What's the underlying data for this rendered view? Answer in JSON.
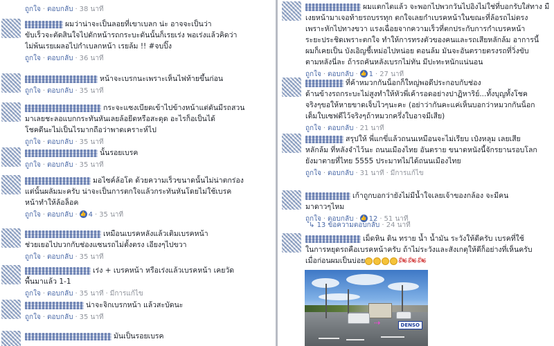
{
  "labels": {
    "like": "ถูกใจ",
    "reply": "ตอบกลับ",
    "edited": "มีการแก้ไข"
  },
  "left": [
    {
      "id": "c0",
      "lines": [],
      "time": "38 นาที",
      "edited": false,
      "reaction": null
    },
    {
      "id": "c1",
      "name_len": 55,
      "lines": [
        "ผมว่าน่าจะเป็นลอยที่เขาเบลก น่ะ อาจจะเป็นว่า",
        "ขับเร็วจะตัดสินใจไปดักหน้ารถกระบะดันนั้นก็เรยเร่ง พอเร่งแล้วคิดว่า",
        "ไม่พ้นเรยเผลอไปกำเบลกหน้า เรยล้ม !! #จบปิ๊ง"
      ],
      "time": "36 นาที",
      "edited": false,
      "reaction": null
    },
    {
      "id": "c2",
      "name_len": 105,
      "lines": [
        "หน้าจะเบรกนะเพราะเห็นไฟท้ายขึ้นก่อน"
      ],
      "time": "35 นาที",
      "edited": false,
      "reaction": null
    },
    {
      "id": "c3",
      "name_len": 110,
      "lines": [
        "กระจะแซงเบียดเข้าไปข้างหน้าแต่ดันมีรถสวน",
        "มาเลยชะลอแบกกระทันหันเลยล้อยีดหรือสะดุด อะไรก็อเป็นได้",
        "โชคดีนะไม่เป็นไรมากถือว่าพาดเคราะห์ไป"
      ],
      "time": "35 นาที",
      "edited": false,
      "reaction": null
    },
    {
      "id": "c4",
      "name_len": 105,
      "lines": [
        "นั้นรอยเบรค"
      ],
      "time": "35 นาที",
      "edited": false,
      "reaction": null
    },
    {
      "id": "c5",
      "name_len": 95,
      "lines": [
        "มอไซค์ล้อโต ด้วยความเร็วขนาดนั้นไม่น่าตกร่อง",
        "แต่นั้นผลัมมะครับ น่าจะเป็นการตกใจแล้วกระทันหันโดยไม่ใช้เบรค",
        "หน้าทำให้ล้อล็อค"
      ],
      "time": "35 นาที",
      "edited": false,
      "reaction": {
        "icon": "like",
        "count": "4"
      }
    },
    {
      "id": "c6",
      "name_len": 110,
      "lines": [
        "เหมือนเบรคหลังแล้วเติมเบรคหน้า",
        "ช่วยเยอไปบวกกับช่องแซนรถไม่ตั้งตรง เอียงๆไปขวา"
      ],
      "time": "35 นาที",
      "edited": false,
      "reaction": null
    },
    {
      "id": "c7",
      "name_len": 95,
      "lines": [
        "เร่ง + เบรคหน้า หรือเร่งแล้วเบรคหน้า เคยวัด",
        "พื้นมาแล้ว 1-1"
      ],
      "time": "35 นาที",
      "edited": true,
      "reaction": null
    },
    {
      "id": "c8",
      "name_len": 85,
      "lines": [
        "น่าจะจิกเบรกหน้า แล้วสะบัดนะ"
      ],
      "time": "35 นาที",
      "edited": false,
      "reaction": null
    },
    {
      "id": "c9",
      "name_len": 125,
      "lines": [
        "มันเป็นรอยเบรค"
      ],
      "time": "",
      "edited": false,
      "reaction": null
    }
  ],
  "right": [
    {
      "id": "r0",
      "name_len": 80,
      "lines": [
        "ผมแตกไตแล้ว จะพอกไปพวกวันไปอิงไม่ใช่ที่บอกรับใส่ทาง มือ",
        "เงยหน้ามาเจอท้ายรถบรรทุก ตกใจเลยกำเบรคหน้าในขณะที่ล้อรถไม่ตรง",
        "เพราะหักไปทางขวา แรงเฉื่อยจากความเร็วที่ตกประกับการกำเบรคหน้า",
        "ระยะประชิดเพราะตกใจ ทำให้การทรงตัวของคนและรถเสียหลักล้ม อาการนี้",
        "ผมก็เคยเป็น บังเอิญชี้เหม่อไปหน่อย ตอนล้ม มันจะอันตรายตรงรถที่วิ่งขับ",
        "ตามหลังนี่ละ ถ้ารถคันหลังเบรกไม่ทัน มีปะทะหนักแน่นอน"
      ],
      "time": "27 นาที",
      "edited": false,
      "reaction": {
        "icon": "like",
        "count": "1"
      }
    },
    {
      "id": "r1",
      "name_len": 55,
      "lines": [
        "ที่ค้าหมวกกันน็อกก็ใหญ่พอดีประกอบกับช่อง",
        "ด้านข้างรถกระบะไม่สูงทำให้หัวพี่เค้ารอดอย่างปาฏิหาริย์...ทั้งบุญทั้งโชค",
        "จริงๆขอให้หายขาดเจ็บไวๆนะคะ (อย่าว่ากันคะแค่เห็นบอกว่าหมวกกันน็อก",
        "เต็มใบเซฟดีไว้จริงๆถ้าหมวกครึ่งใบอาจมีเสีย)"
      ],
      "time": "21 นาที",
      "edited": false,
      "reaction": null
    },
    {
      "id": "r2",
      "name_len": 55,
      "lines": [
        "สรุปให้ พี่แกขี่แล้วถนนเหมือนจะไม่เรียบ เป๋งหลุม เลยเสีย",
        "หลักล้ม ที่หลังจำไว้นะ ถนนเมืองไทย อันตราย ขนาดหนังนี้จักรยานรอบโลก",
        "ยังมาตายที่ไทย 5555 ประมาทไม่ได้ถนนเมืองไทย"
      ],
      "time": "31 นาที",
      "edited": true,
      "reaction": null
    },
    {
      "id": "r3",
      "name_len": 65,
      "lines": [
        "เก้าถูกบอกว่ายังไม่มีน้ำใจเลยเจ้าของกล้อง จะมีคน",
        "มาดาวๆไหม"
      ],
      "time": "51 นาที",
      "edited": false,
      "reaction": {
        "icon": "like",
        "count": "12"
      }
    },
    {
      "id": "r4",
      "name_len": 80,
      "lines": [
        "เม็ดหิน ดิน ทราย น้ำ น้ำมัน ระวังให้ดีครับ เบรคที่ใช้",
        "ในการหยุดรถคือเบรคหน้าครับ ถ้าไม่ระวังและสังเกตุให้ดีก็อย่างที่เห็นครับ",
        "เมื่อก่อนผมเป็นบ่อย"
      ],
      "time": "",
      "edited": false,
      "reaction": null
    }
  ],
  "replies_link": {
    "label": "13 ข้อความตอบกลับ",
    "time": "24 นาที"
  },
  "thumbnail": {
    "brand_logo": "DENSO"
  }
}
